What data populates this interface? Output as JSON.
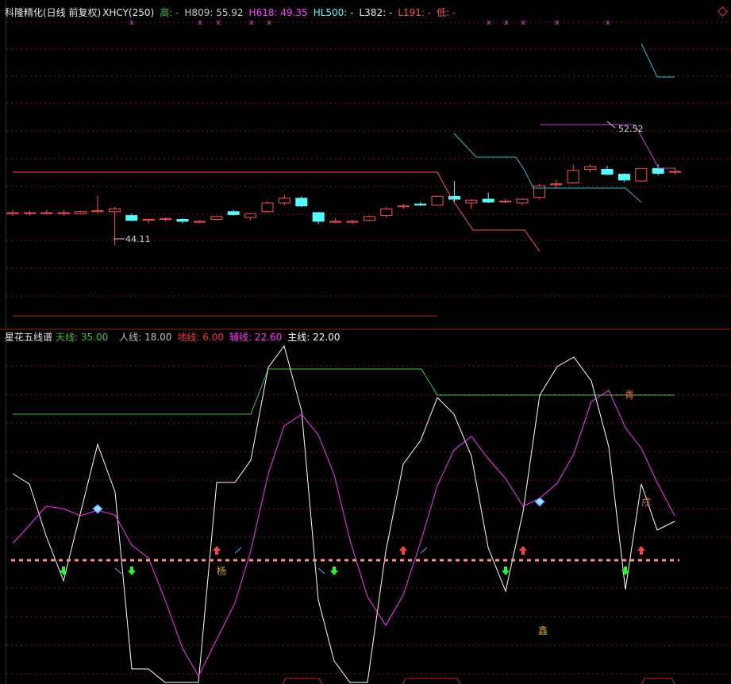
{
  "main_header": {
    "title": "科隆精化(日线 前复权)",
    "code": "XHCY(250)",
    "high": "高: -",
    "h809": "H809: 55.92",
    "h618": "H618: 49.35",
    "hl500": "HL500: -",
    "l382": "L382: -",
    "l191": "L191: -",
    "low": "低: -"
  },
  "sub_header": {
    "title": "星花五线谱",
    "tian": "天线: 35.00",
    "ren": "人线: 18.00",
    "di": "地线: 6.00",
    "fu": "辅线: 22.60",
    "zhu": "主线: 22.00"
  },
  "annotations": {
    "price_high_label": "52.52",
    "price_low_label": "44.11",
    "char_qing": "青",
    "char_yang": "杨",
    "char_xin": "鑫",
    "char_xu": "戌"
  },
  "colors": {
    "up": "#ff5050",
    "down": "#54ffff",
    "tian": "#40c040",
    "ren": "#c0c0c0",
    "di": "#ff3030",
    "fu": "#ff30ff",
    "zhu": "#ffffff",
    "grid": "#7a1a1a"
  },
  "chart_data": [
    {
      "type": "candlestick",
      "title": "科隆精化(日线 前复权)",
      "series": [
        {
          "o": 47.5,
          "h": 47.8,
          "l": 47.2,
          "c": 47.5
        },
        {
          "o": 47.4,
          "h": 47.7,
          "l": 47.2,
          "c": 47.5
        },
        {
          "o": 47.5,
          "h": 47.8,
          "l": 47.3,
          "c": 47.5
        },
        {
          "o": 47.5,
          "h": 47.8,
          "l": 47.2,
          "c": 47.5
        },
        {
          "o": 47.4,
          "h": 47.7,
          "l": 47.3,
          "c": 47.6
        },
        {
          "o": 47.6,
          "h": 49.3,
          "l": 47.5,
          "c": 47.7
        },
        {
          "o": 47.6,
          "h": 48.1,
          "l": 44.11,
          "c": 47.9
        },
        {
          "o": 47.2,
          "h": 47.4,
          "l": 46.6,
          "c": 46.7
        },
        {
          "o": 46.7,
          "h": 46.9,
          "l": 46.4,
          "c": 46.8
        },
        {
          "o": 46.8,
          "h": 47.0,
          "l": 46.6,
          "c": 46.9
        },
        {
          "o": 46.8,
          "h": 46.9,
          "l": 46.4,
          "c": 46.6
        },
        {
          "o": 46.5,
          "h": 46.7,
          "l": 46.4,
          "c": 46.6
        },
        {
          "o": 46.8,
          "h": 47.2,
          "l": 46.7,
          "c": 47.1
        },
        {
          "o": 47.6,
          "h": 47.8,
          "l": 47.2,
          "c": 47.3
        },
        {
          "o": 47.0,
          "h": 47.5,
          "l": 46.7,
          "c": 47.4
        },
        {
          "o": 47.6,
          "h": 48.7,
          "l": 47.5,
          "c": 48.5
        },
        {
          "o": 48.5,
          "h": 49.3,
          "l": 48.3,
          "c": 49.0
        },
        {
          "o": 49.0,
          "h": 49.2,
          "l": 48.1,
          "c": 48.2
        },
        {
          "o": 47.5,
          "h": 47.6,
          "l": 46.3,
          "c": 46.6
        },
        {
          "o": 46.6,
          "h": 46.9,
          "l": 46.4,
          "c": 46.6
        },
        {
          "o": 46.5,
          "h": 46.8,
          "l": 46.3,
          "c": 46.6
        },
        {
          "o": 46.7,
          "h": 47.2,
          "l": 46.6,
          "c": 47.1
        },
        {
          "o": 47.2,
          "h": 48.1,
          "l": 47.0,
          "c": 47.9
        },
        {
          "o": 48.1,
          "h": 48.4,
          "l": 47.9,
          "c": 48.2
        },
        {
          "o": 48.4,
          "h": 48.6,
          "l": 48.2,
          "c": 48.3
        },
        {
          "o": 48.3,
          "h": 49.3,
          "l": 48.2,
          "c": 49.2
        },
        {
          "o": 49.2,
          "h": 50.8,
          "l": 48.6,
          "c": 48.9
        },
        {
          "o": 48.5,
          "h": 48.9,
          "l": 47.9,
          "c": 48.8
        },
        {
          "o": 48.9,
          "h": 49.6,
          "l": 48.5,
          "c": 48.6
        },
        {
          "o": 48.6,
          "h": 48.9,
          "l": 48.5,
          "c": 48.7
        },
        {
          "o": 48.5,
          "h": 49.0,
          "l": 48.3,
          "c": 48.9
        },
        {
          "o": 49.1,
          "h": 50.5,
          "l": 48.9,
          "c": 50.3
        },
        {
          "o": 50.4,
          "h": 50.9,
          "l": 50.1,
          "c": 50.5
        },
        {
          "o": 50.6,
          "h": 52.5,
          "l": 50.5,
          "c": 51.9
        },
        {
          "o": 52.0,
          "h": 52.5,
          "l": 51.7,
          "c": 52.3
        },
        {
          "o": 52.0,
          "h": 52.4,
          "l": 51.4,
          "c": 51.5
        },
        {
          "o": 51.5,
          "h": 51.6,
          "l": 50.7,
          "c": 50.9
        },
        {
          "o": 50.8,
          "h": 52.1,
          "l": 50.7,
          "c": 52.1
        },
        {
          "o": 52.1,
          "h": 52.52,
          "l": 51.4,
          "c": 51.6
        },
        {
          "o": 51.8,
          "h": 52.2,
          "l": 51.5,
          "c": 51.8
        }
      ],
      "price_axis": [
        43.5,
        57.0
      ],
      "h809_line": [
        55.92
      ],
      "h618_line": [
        49.35
      ]
    },
    {
      "type": "line",
      "title": "星花五线谱",
      "tian": 35.0,
      "ren": 18.0,
      "di": 6.0,
      "fu": 22.6,
      "zhu": 22.0,
      "ylim": [
        -12,
        48
      ]
    }
  ]
}
